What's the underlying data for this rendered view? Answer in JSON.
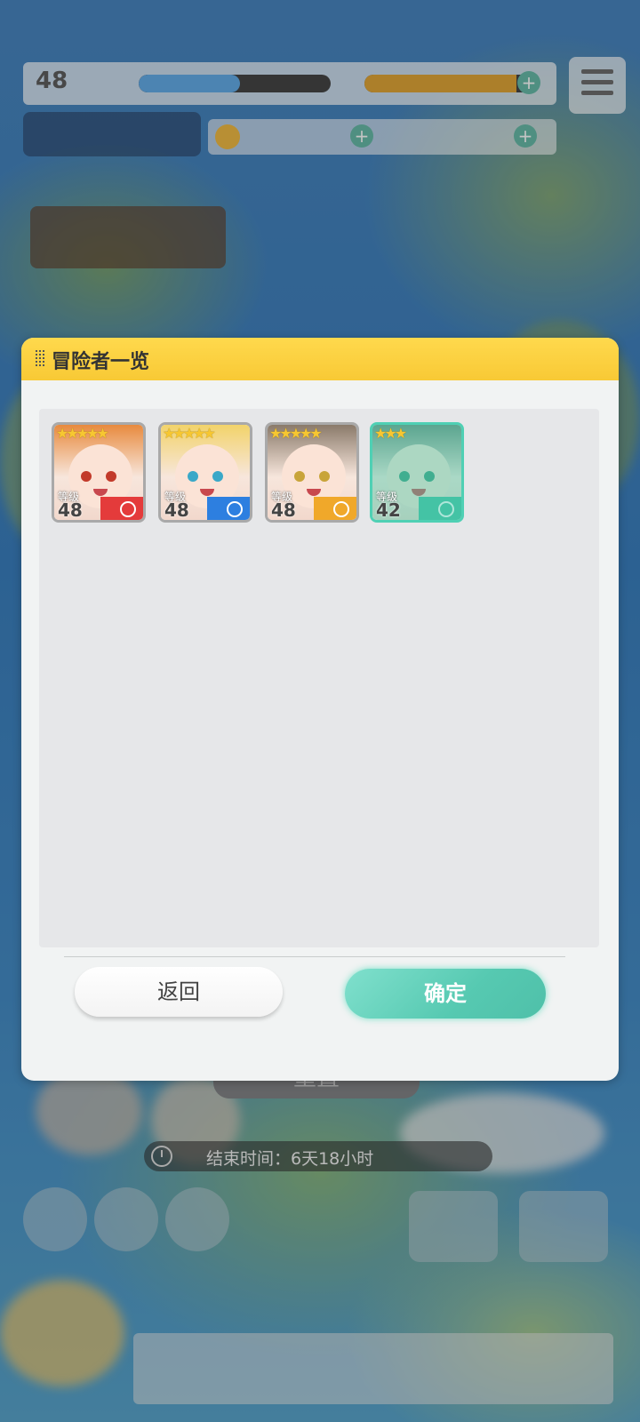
{
  "hud": {
    "level": "48",
    "stamina_fraction": 0.53,
    "exp_fraction": 0.9
  },
  "dialog": {
    "title": "冒险者一览",
    "back_label": "返回",
    "confirm_label": "确定"
  },
  "adventurers": [
    {
      "stars": 5,
      "level_label": "等级",
      "level": "48",
      "attribute": "fire",
      "accent": "#e43b3b",
      "hair": "#e88a3e",
      "eye": "#c23a2a",
      "selected": false
    },
    {
      "stars": 5,
      "level_label": "等级",
      "level": "48",
      "attribute": "water",
      "accent": "#2d7fe0",
      "hair": "#f2d36a",
      "eye": "#3aa8c8",
      "selected": false
    },
    {
      "stars": 5,
      "level_label": "等级",
      "level": "48",
      "attribute": "light",
      "accent": "#f0a82a",
      "hair": "#8a7a6a",
      "eye": "#c8a43a",
      "selected": false
    },
    {
      "stars": 3,
      "level_label": "等级",
      "level": "42",
      "attribute": "wind",
      "accent": "#3fc0a0",
      "hair": "#6a8a7a",
      "eye": "#3a9a7a",
      "selected": true
    }
  ],
  "background": {
    "reset_label": "重置",
    "end_time": "结束时间：6天18小时"
  },
  "colors": {
    "header_yellow": "#ffd94d",
    "confirm_teal": "#56c9b1"
  }
}
